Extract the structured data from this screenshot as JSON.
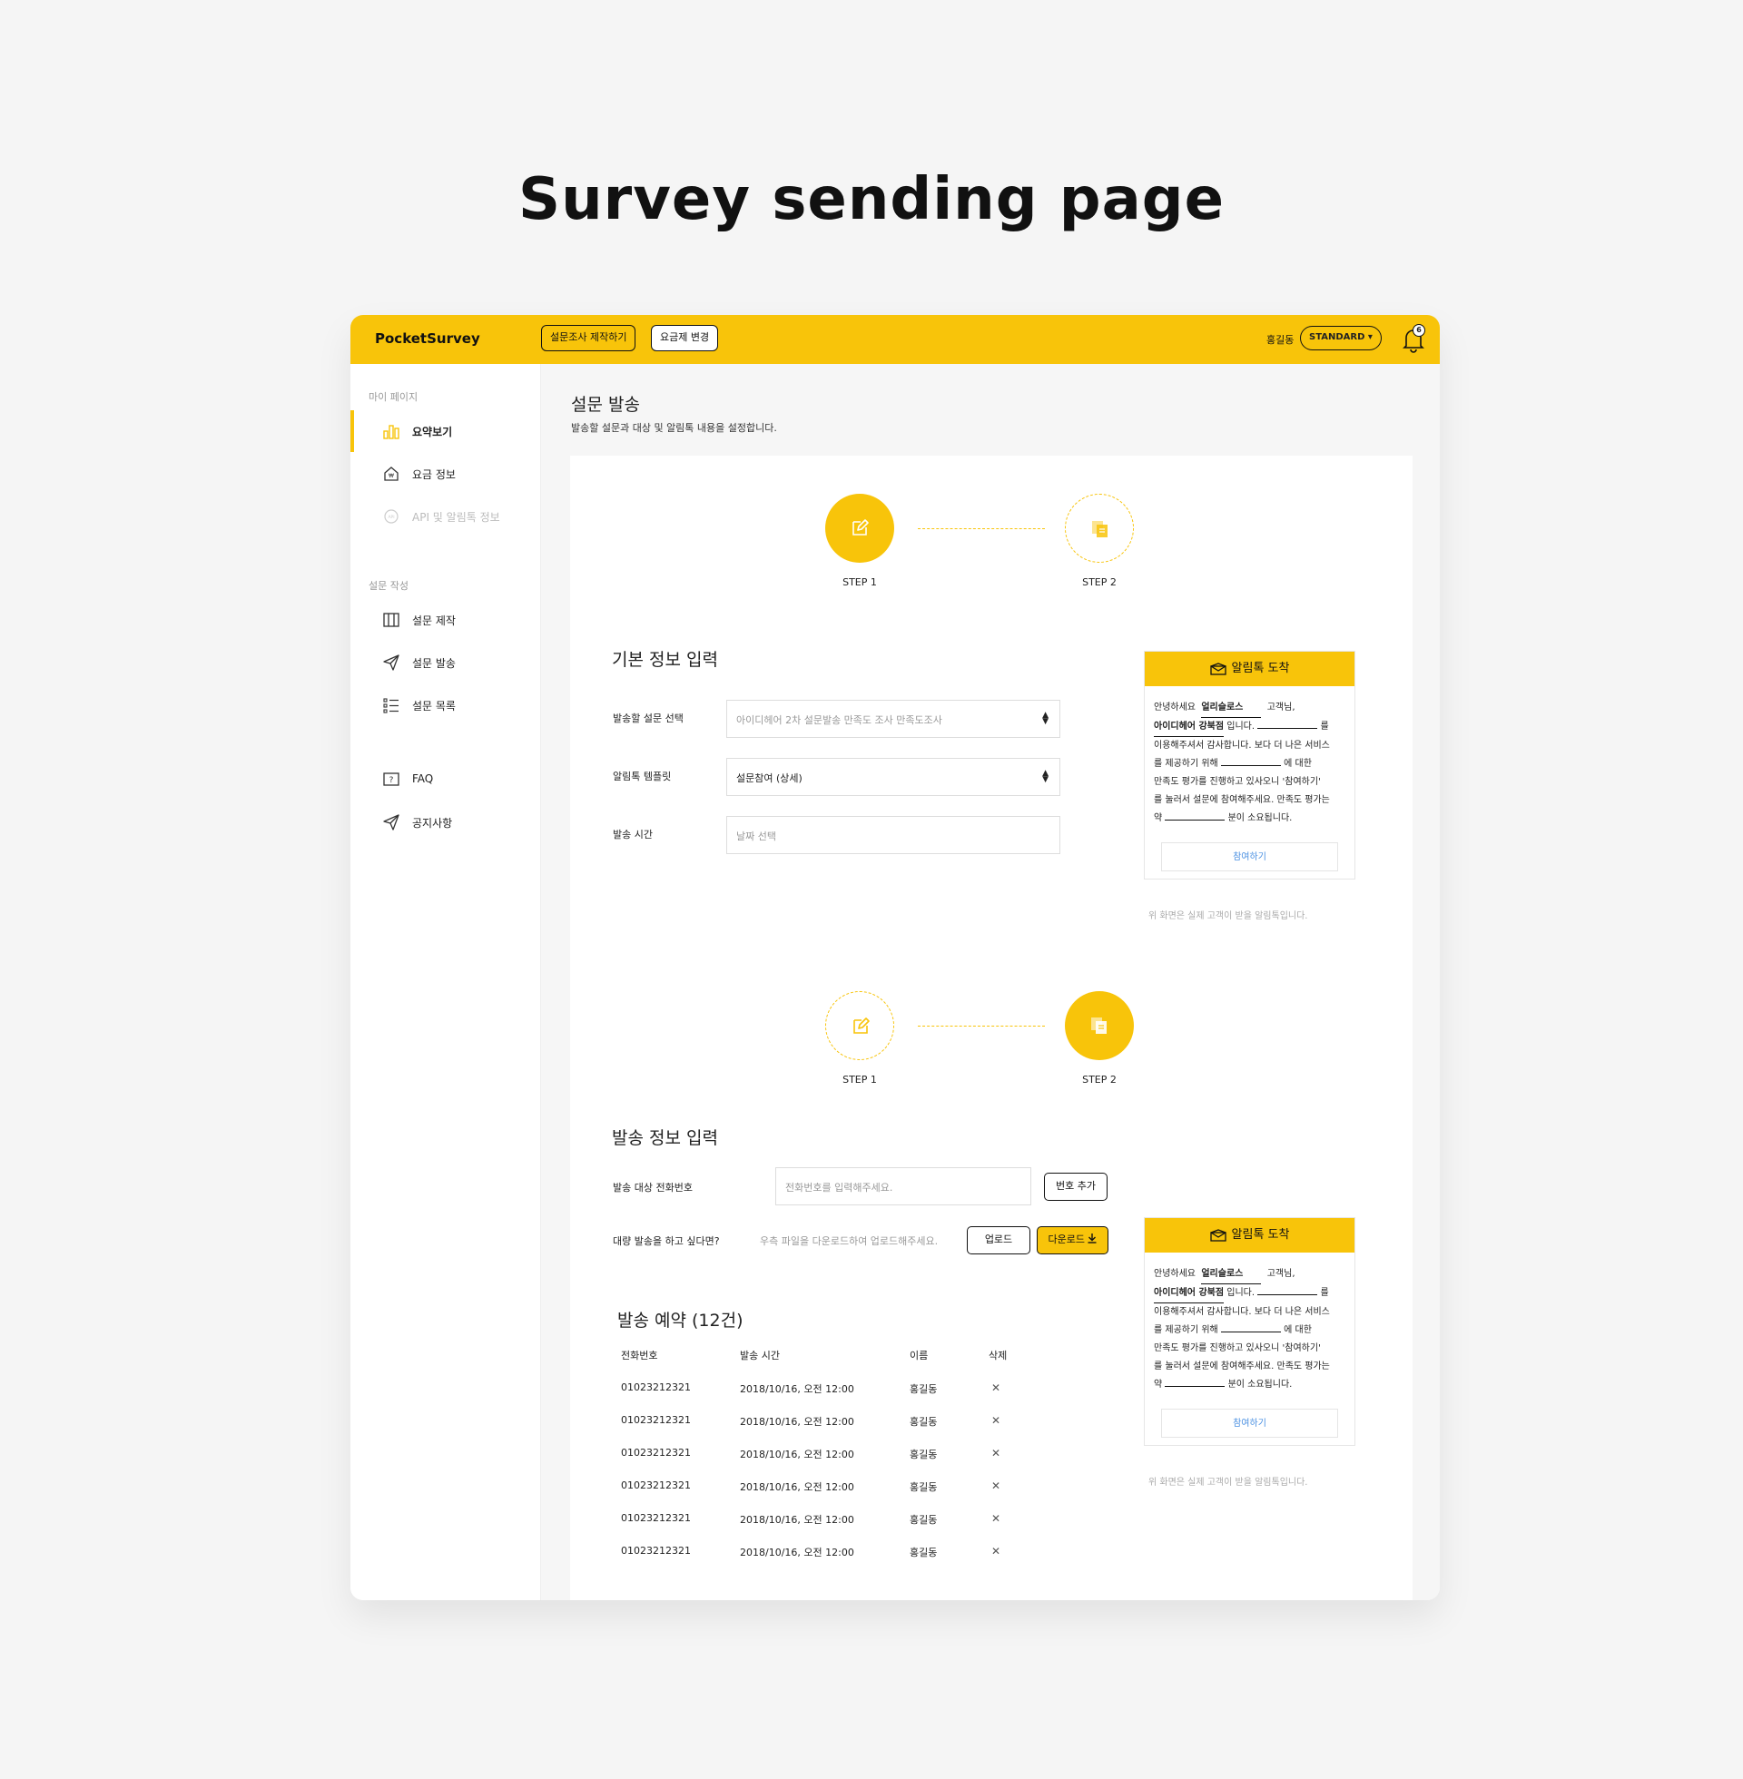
{
  "page_heading": "Survey sending page",
  "header": {
    "logo": "PocketSurvey",
    "create_survey_button": "설문조사 제작하기",
    "change_plan_button": "요금제 변경",
    "user_name": "홍길동",
    "plan": "STANDARD ▾",
    "notification_count": "6"
  },
  "sidebar": {
    "section_mypage": "마이 페이지",
    "items_mypage": [
      {
        "label": "요약보기",
        "icon": "bar-chart-icon"
      },
      {
        "label": "요금 정보",
        "icon": "home-won-icon"
      },
      {
        "label": "API 및 알림톡 정보",
        "icon": "api-icon"
      }
    ],
    "section_survey": "설문 작성",
    "items_survey": [
      {
        "label": "설문 제작",
        "icon": "book-icon"
      },
      {
        "label": "설문 발송",
        "icon": "send-icon"
      },
      {
        "label": "설문 목록",
        "icon": "list-icon"
      }
    ],
    "items_support": [
      {
        "label": "FAQ",
        "icon": "question-icon"
      },
      {
        "label": "공지사항",
        "icon": "send-icon"
      }
    ]
  },
  "main": {
    "title": "설문 발송",
    "subtitle": "발송할 설문과 대상 및 알림톡 내용을 설정합니다."
  },
  "steps": {
    "step1": "STEP 1",
    "step2": "STEP 2"
  },
  "basic_info": {
    "title": "기본 정보 입력",
    "survey_label": "발송할 설문 선택",
    "survey_value": "아이디헤어 2차 설문발송 만족도 조사 만족도조사",
    "template_label": "알림톡 템플릿",
    "template_value": "설문참여 (상세)",
    "time_label": "발송 시간",
    "time_placeholder": "날짜 선택"
  },
  "preview": {
    "header": "알림톡 도착",
    "greeting": "안녕하세요",
    "company": "얼리슬로스",
    "customer_suffix": "고객님,",
    "shop": "아이디헤어 강북점",
    "shop_suffix": "입니다.",
    "particle1": "를",
    "line3": "이용해주셔서 감사합니다. 보다 더 나은 서비스",
    "line4_prefix": "를 제공하기 위해",
    "line4_suffix": "에 대한",
    "line5": "만족도 평가를 진행하고 있사오니 '참여하기'",
    "line6": "를 눌러서 설문에 참여해주세요. 만족도 평가는",
    "line7_prefix": "약",
    "line7_suffix": "분이 소요됩니다.",
    "button": "참여하기",
    "note": "위 화면은 실제 고객이 받을 알림톡입니다."
  },
  "send_info": {
    "title": "발송 정보 입력",
    "phone_label": "발송 대상 전화번호",
    "phone_placeholder": "전화번호를 입력해주세요.",
    "add_button": "번호 추가",
    "bulk_label": "대량 발송을 하고 싶다면?",
    "bulk_hint": "우측 파일을 다운로드하여 업로드해주세요.",
    "upload_button": "업로드",
    "download_button": "다운로드"
  },
  "reservations": {
    "title": "발송 예약 (12건)",
    "columns": [
      "전화번호",
      "발송 시간",
      "이름",
      "삭제"
    ],
    "rows": [
      {
        "phone": "01023212321",
        "time": "2018/10/16, 오전 12:00",
        "name": "홍길동"
      },
      {
        "phone": "01023212321",
        "time": "2018/10/16, 오전 12:00",
        "name": "홍길동"
      },
      {
        "phone": "01023212321",
        "time": "2018/10/16, 오전 12:00",
        "name": "홍길동"
      },
      {
        "phone": "01023212321",
        "time": "2018/10/16, 오전 12:00",
        "name": "홍길동"
      },
      {
        "phone": "01023212321",
        "time": "2018/10/16, 오전 12:00",
        "name": "홍길동"
      },
      {
        "phone": "01023212321",
        "time": "2018/10/16, 오전 12:00",
        "name": "홍길동"
      }
    ],
    "delete_symbol": "✕"
  },
  "colors": {
    "accent": "#f8c40a",
    "link": "#4a90e2"
  }
}
